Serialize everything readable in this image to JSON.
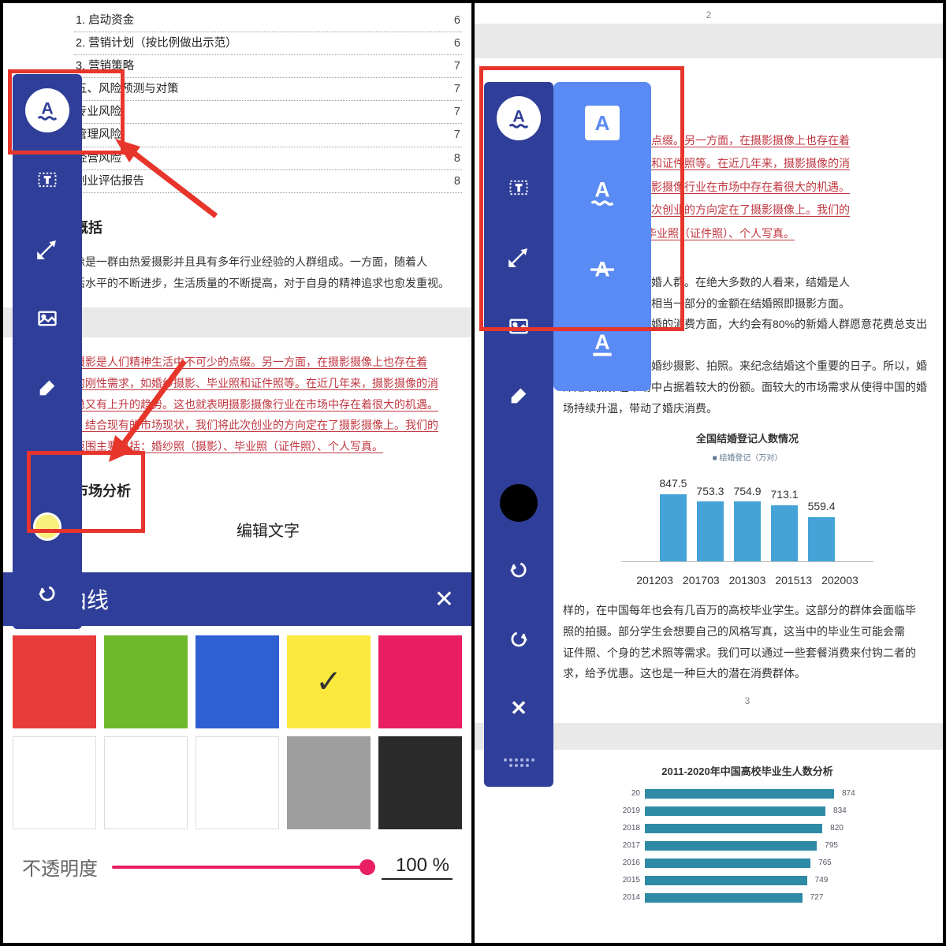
{
  "panel_title": "波形曲线",
  "opacity_label": "不透明度",
  "opacity_value": "100 %",
  "edit_text_label": "编辑文字",
  "toc": [
    {
      "t": "1. 启动资金",
      "p": "6"
    },
    {
      "t": "2. 营销计划（按比例做出示范）",
      "p": "6"
    },
    {
      "t": "3. 营销策略",
      "p": "7"
    },
    {
      "t": "五、风险预测与对策",
      "p": "7"
    },
    {
      "t": "专业风险",
      "p": "7"
    },
    {
      "t": "管理风险",
      "p": "7"
    },
    {
      "t": "经营风险",
      "p": "8"
    },
    {
      "t": "创业评估报告",
      "p": "8"
    }
  ],
  "left_h1": "概括",
  "left_p1a": "像是一群由热爱摄影并且具有多年行业经验的人群组成。一方面，随着人",
  "left_p1b": "活水平的不断进步，生活质量的不断提高，对于自身的精神追求也愈发重视。",
  "left_red": [
    "摄影是人们精神生活中不可少的点缀。另一方面，在摄影摄像上也存在着",
    "的刚性需求，如婚纱摄影、毕业照和证件照等。在近几年来，摄影摄像的消",
    "稳又有上升的趋势。这也就表明摄影摄像行业在市场中存在着很大的机遇。",
    "。结合现有的市场现状，我们将此次创业的方向定在了摄影摄像上。我们的",
    "范围主要包括：婚纱照（摄影）、毕业照（证件照）、个人写真。"
  ],
  "left_h2": "市场分析",
  "right_red": [
    "神生活必不可少的点缀。另一方面，在摄影摄像上也存在着",
    "婚纱摄影、毕业照和证件照等。在近几年来，摄影摄像的消",
    "势。这也就表明摄影摄像行业在市场中存在着很大的机遇。",
    "场现状，我们将此次创业的方向定在了摄影摄像上。我们的",
    "婚纱照（摄影）、毕业照（证件照）、个人写真。"
  ],
  "right_para1": [
    "年会有几百万的结婚人群。在绝大多数的人看来，结婚是人",
    "。他们会愿意花费相当一部分的金额在结婚照即摄影方面。",
    "不完全统计，在新婚的消费方面，大约会有80%的新婚人群愿意花费总支出的",
    "20%来购买婚纱和婚纱摄影、拍照。来纪念结婚这个重要的日子。所以，婚",
    "即婚纱摄影在市场中占据着较大的份额。面较大的市场需求从使得中国的婚",
    "场持续升温，带动了婚庆消费。"
  ],
  "right_para2": [
    "样的，在中国每年也会有几百万的高校毕业学生。这部分的群体会面临毕",
    "照的拍摄。部分学生会想要自己的风格写真，这当中的毕业生可能会需",
    "证件照、个身的艺术照等需求。我们可以通过一些套餐消费来付钩二者的",
    "求，给予优惠。这也是一种巨大的潜在消费群体。"
  ],
  "chart_data": [
    {
      "type": "bar",
      "title": "全国结婚登记人数情况",
      "legend": "结婚登记（万对）",
      "categories": [
        "201203",
        "201703",
        "201303",
        "201513",
        "202003"
      ],
      "values": [
        847.5,
        753.3,
        754.9,
        713.1,
        559.4
      ],
      "ylim": [
        0,
        1000
      ]
    },
    {
      "type": "bar",
      "orientation": "horizontal",
      "title": "2011-2020年中国高校毕业生人数分析",
      "categories": [
        "20",
        "2019",
        "2018",
        "2017",
        "2016",
        "2015",
        "2014"
      ],
      "values": [
        874,
        834,
        820,
        795,
        765,
        749,
        727
      ]
    }
  ],
  "colors": {
    "row1": [
      "#e73c3a",
      "#6eb92b",
      "#2e60d4",
      "#fce93f",
      "#e91e63"
    ],
    "row2": [
      "#ffffff",
      "#ffffff",
      "#ffffff",
      "#9e9e9e",
      "#2b2b2b"
    ]
  },
  "color_selected_index": 3,
  "page_small": "3",
  "tools_left": [
    "text",
    "textbox",
    "line",
    "image",
    "eraser"
  ],
  "tools_right": [
    "text",
    "textbox",
    "line",
    "image",
    "eraser"
  ],
  "submenu_items": [
    "highlight-box",
    "underline-wavy",
    "strikethrough",
    "text-color"
  ]
}
